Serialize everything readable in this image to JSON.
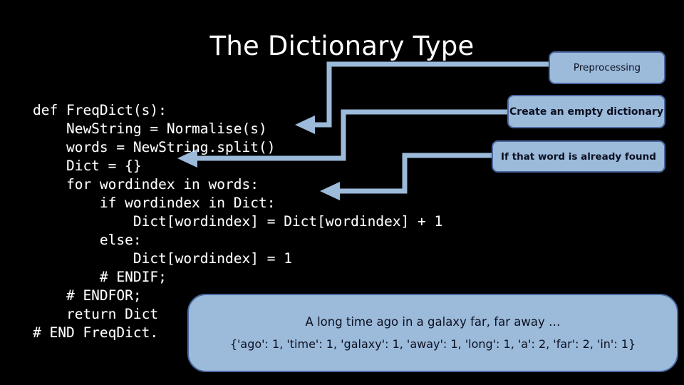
{
  "slide": {
    "title": "The Dictionary Type",
    "background_color": "#000000",
    "text_color": "#FFFFFF",
    "accent_color": "#9CBADA",
    "border_color": "#4A68A0"
  },
  "code": {
    "language": "python",
    "lines": [
      "def FreqDict(s):",
      "    NewString = Normalise(s)",
      "    words = NewString.split()",
      "    Dict = {}",
      "    for wordindex in words:",
      "        if wordindex in Dict:",
      "            Dict[wordindex] = Dict[wordindex] + 1",
      "        else:",
      "            Dict[wordindex] = 1",
      "        # ENDIF;",
      "    # ENDFOR;",
      "    return Dict",
      "# END FreqDict."
    ]
  },
  "callouts": [
    {
      "id": "preprocessing",
      "label": "Preprocessing"
    },
    {
      "id": "empty_dict",
      "label": "Create an empty dictionary"
    },
    {
      "id": "already_found",
      "label": "If that word is already found"
    }
  ],
  "output": {
    "sentence": "A long time ago in a galaxy far, far away …",
    "dictionary": "{'ago': 1, 'time': 1, 'galaxy': 1, 'away': 1, 'long': 1, 'a': 2, 'far': 2, 'in': 1}",
    "entries": [
      {
        "word": "ago",
        "count": 1
      },
      {
        "word": "time",
        "count": 1
      },
      {
        "word": "galaxy",
        "count": 1
      },
      {
        "word": "away",
        "count": 1
      },
      {
        "word": "long",
        "count": 1
      },
      {
        "word": "a",
        "count": 2
      },
      {
        "word": "far",
        "count": 2
      },
      {
        "word": "in",
        "count": 1
      }
    ]
  },
  "connectors": [
    {
      "id": "arrow-preprocessing",
      "from": "preprocessing",
      "to_code_line": 2,
      "color": "#9CBADA"
    },
    {
      "id": "arrow-empty-dict",
      "from": "empty_dict",
      "to_code_line": 4,
      "color": "#9CBADA"
    },
    {
      "id": "arrow-already-found",
      "from": "already_found",
      "to_code_line": 6,
      "color": "#9CBADA"
    }
  ]
}
